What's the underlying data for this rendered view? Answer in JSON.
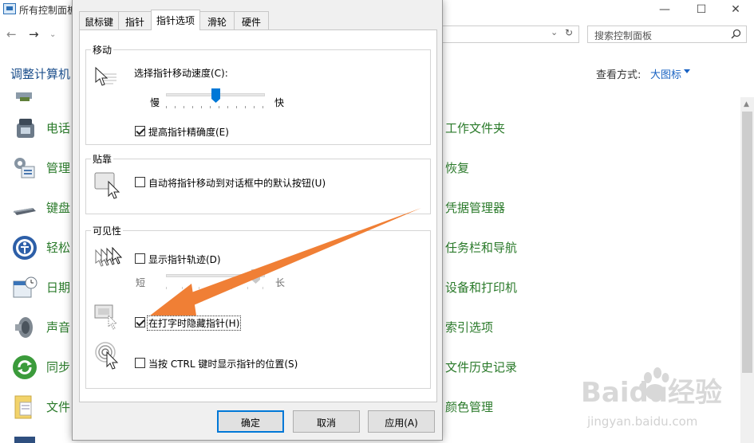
{
  "window": {
    "title": "所有控制面板",
    "search_placeholder": "搜索控制面板",
    "adjust_label": "调整计算机",
    "view_by_label": "查看方式:",
    "view_by_value": "大图标"
  },
  "control_panel": {
    "left_items": [
      {
        "label": "电话",
        "icon": "phone-icon"
      },
      {
        "label": "管理",
        "icon": "admin-tools-icon"
      },
      {
        "label": "键盘",
        "icon": "keyboard-icon"
      },
      {
        "label": "轻松",
        "icon": "ease-of-access-icon"
      },
      {
        "label": "日期",
        "icon": "calendar-icon"
      },
      {
        "label": "声音",
        "icon": "speaker-icon"
      },
      {
        "label": "同步",
        "icon": "sync-icon"
      },
      {
        "label": "文件",
        "icon": "file-icon"
      }
    ],
    "right_items": [
      {
        "label": "工作文件夹"
      },
      {
        "label": "恢复"
      },
      {
        "label": "凭据管理器"
      },
      {
        "label": "任务栏和导航"
      },
      {
        "label": "设备和打印机"
      },
      {
        "label": "索引选项"
      },
      {
        "label": "文件历史记录"
      },
      {
        "label": "颜色管理"
      }
    ]
  },
  "dialog": {
    "tabs": [
      "鼠标键",
      "指针",
      "指针选项",
      "滑轮",
      "硬件"
    ],
    "active_tab": 2,
    "motion": {
      "title": "移动",
      "speed_label": "选择指针移动速度(C):",
      "slow": "慢",
      "fast": "快",
      "speed_value": 0.5,
      "precision_label": "提高指针精确度(E)",
      "precision_checked": true
    },
    "snap": {
      "title": "贴靠",
      "snap_label": "自动将指针移动到对话框中的默认按钮(U)",
      "snap_checked": false
    },
    "visibility": {
      "title": "可见性",
      "trails_label": "显示指针轨迹(D)",
      "trails_checked": false,
      "short": "短",
      "long": "长",
      "trails_value": 0.95,
      "hide_label": "在打字时隐藏指针(H)",
      "hide_checked": true,
      "ctrl_label": "当按 CTRL 键时显示指针的位置(S)",
      "ctrl_checked": false
    },
    "buttons": {
      "ok": "确定",
      "cancel": "取消",
      "apply": "应用(A)"
    }
  },
  "watermark": {
    "brand": "Baidu经验",
    "url": "jingyan.baidu.com"
  },
  "colors": {
    "accent": "#0078d7",
    "arrow": "#f07f35",
    "link_green": "#2a7a2a",
    "link_blue": "#1a63c3"
  }
}
